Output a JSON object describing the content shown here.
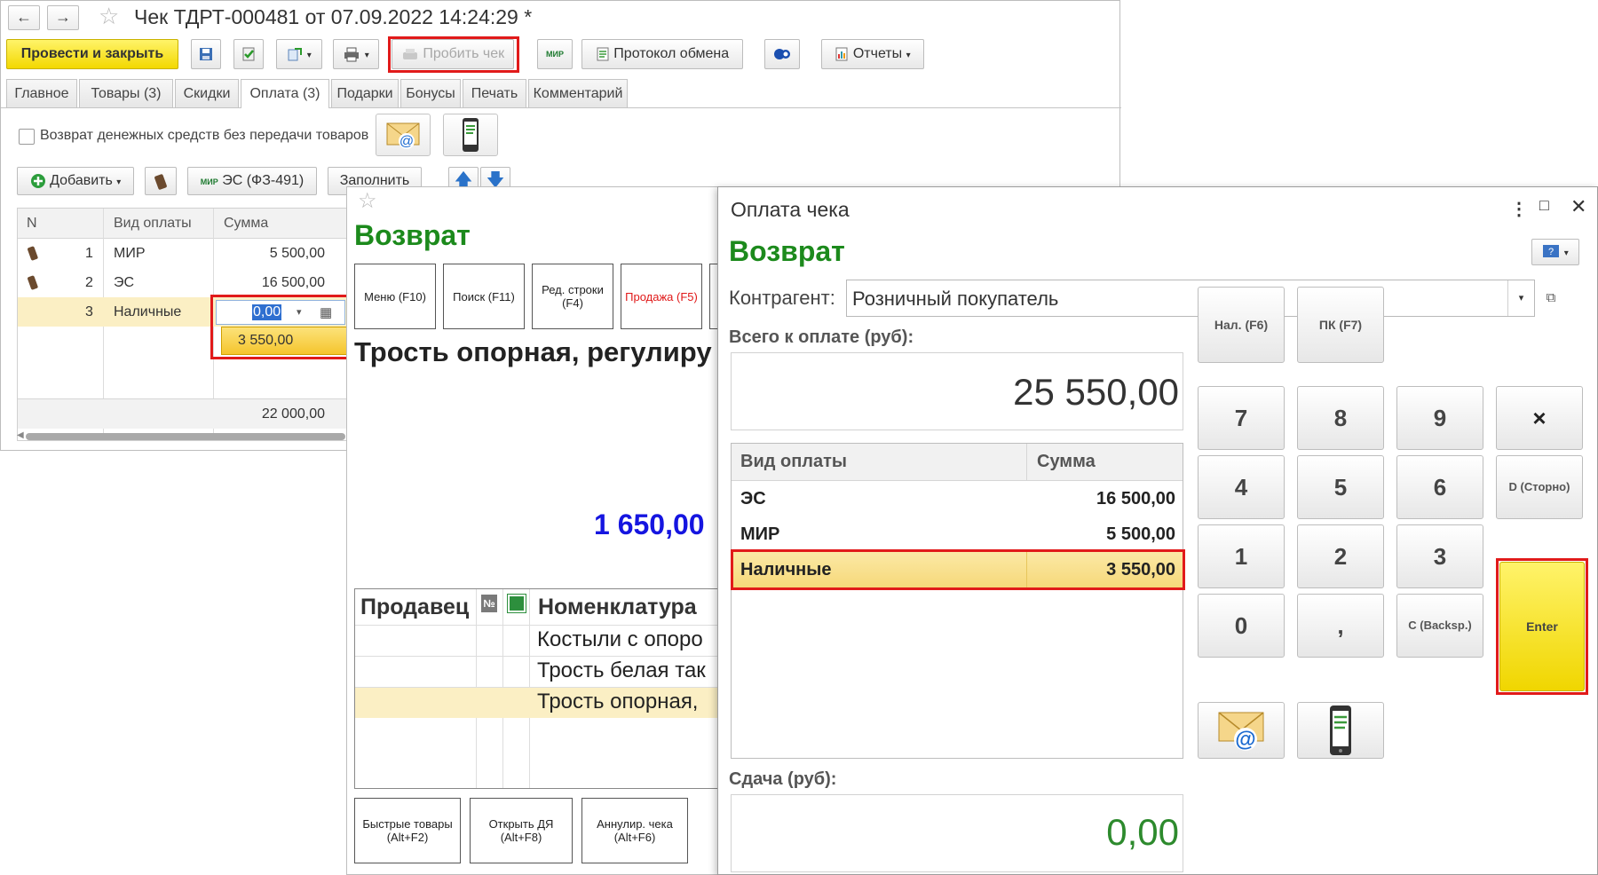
{
  "doc_window": {
    "title": "Чек ТДРТ-000481 от 07.09.2022 14:24:29 *",
    "toolbar": {
      "post_close": "Провести и закрыть",
      "print_receipt": "Пробить чек",
      "mir_label": "МИР",
      "exchange_log": "Протокол обмена",
      "reports": "Отчеты"
    },
    "tabs": [
      "Главное",
      "Товары (3)",
      "Скидки",
      "Оплата (3)",
      "Подарки",
      "Бонусы",
      "Печать",
      "Комментарий"
    ],
    "refund_checkbox_label": "Возврат денежных средств без передачи товаров",
    "add_button": "Добавить",
    "es_button": "ЭС (ФЗ-491)",
    "fill_button": "Заполнить",
    "grid": {
      "columns": [
        "N",
        "Вид оплаты",
        "Сумма"
      ],
      "rows": [
        {
          "n": "1",
          "type": "МИР",
          "sum": "5 500,00"
        },
        {
          "n": "2",
          "type": "ЭС",
          "sum": "16 500,00"
        },
        {
          "n": "3",
          "type": "Наличные",
          "sum": "0,00"
        }
      ],
      "dropdown_value": "3 550,00",
      "total": "22 000,00"
    }
  },
  "pos_window": {
    "heading": "Возврат",
    "fkeys": [
      "Меню (F10)",
      "Поиск (F11)",
      "Ред. строки (F4)",
      "Продажа (F5)"
    ],
    "item_name": "Трость опорная, регулиру",
    "amount": "1 650,00",
    "table": {
      "columns": [
        "Продавец",
        "№",
        "Номенклатура"
      ],
      "rows": [
        "Костыли с опоро",
        "Трость белая так",
        "Трость опорная,"
      ]
    },
    "bottom_keys": [
      "Быстрые товары (Alt+F2)",
      "Открыть ДЯ (Alt+F8)",
      "Аннулир. чека (Alt+F6)"
    ]
  },
  "payment_dialog": {
    "title": "Оплата чека",
    "heading": "Возврат",
    "contractor_label": "Контрагент:",
    "contractor_value": "Розничный покупатель",
    "total_label": "Всего к оплате (руб):",
    "total_value": "25 550,00",
    "table": {
      "col_type": "Вид оплаты",
      "col_sum": "Сумма",
      "rows": [
        {
          "type": "ЭС",
          "sum": "16 500,00"
        },
        {
          "type": "МИР",
          "sum": "5 500,00"
        },
        {
          "type": "Наличные",
          "sum": "3 550,00"
        }
      ]
    },
    "change_label": "Сдача (руб):",
    "change_value": "0,00",
    "keys": {
      "cash": "Нал. (F6)",
      "card": "ПК (F7)",
      "k7": "7",
      "k8": "8",
      "k9": "9",
      "kx": "×",
      "k4": "4",
      "k5": "5",
      "k6": "6",
      "storno": "D (Сторно)",
      "k1": "1",
      "k2": "2",
      "k3": "3",
      "enter": "Enter",
      "k0": "0",
      "comma": ",",
      "backsp": "C (Backsp.)"
    }
  },
  "colors": {
    "accent_yellow": "#f3d800",
    "heading_green": "#1c8a1c",
    "amount_blue": "#1515e0",
    "highlight_red": "#e11a1a"
  }
}
